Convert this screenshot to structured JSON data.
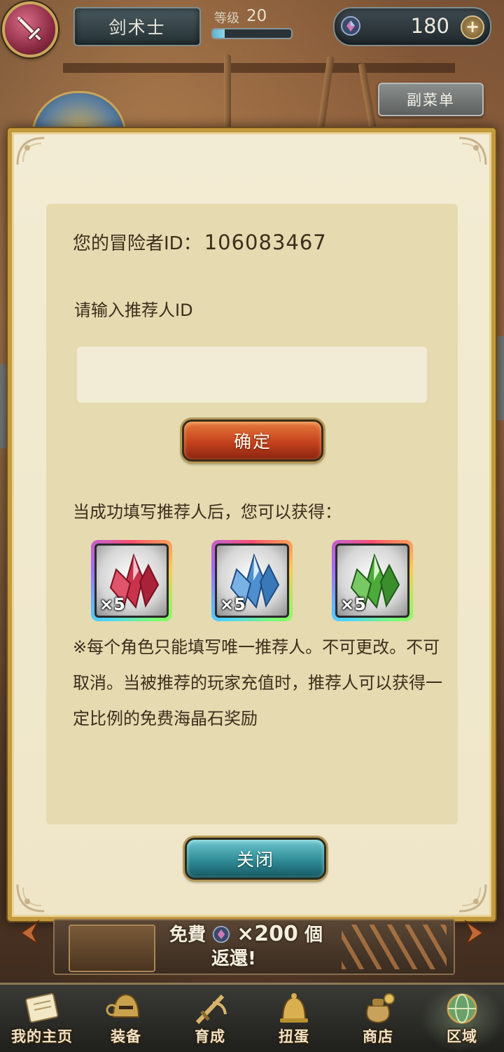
{
  "header": {
    "character_name": "剑术士",
    "level_label": "等级",
    "level_value": "20",
    "level_progress_fraction": 0.15,
    "gem_count": "180",
    "submenu_label": "副菜单"
  },
  "dialog": {
    "adventurer_id_label": "您的冒险者ID：",
    "adventurer_id": "106083467",
    "referrer_prompt": "请输入推荐人ID",
    "referrer_input_value": "",
    "confirm_label": "确定",
    "reward_intro": "当成功填写推荐人后，您可以获得：",
    "rewards": [
      {
        "name": "red-crystal-icon",
        "color": "#c8324a",
        "quantity": "×5"
      },
      {
        "name": "blue-crystal-icon",
        "color": "#4f8fd0",
        "quantity": "×5"
      },
      {
        "name": "green-crystal-icon",
        "color": "#4caa3a",
        "quantity": "×5"
      }
    ],
    "notice": "※每个角色只能填写唯一推荐人。不可更改。不可取消。当被推荐的玩家充值时，推荐人可以获得一定比例的免费海晶石奖励",
    "close_label": "关闭"
  },
  "banner": {
    "free_label": "免費",
    "amount": "×200",
    "unit": "個",
    "line2": "返還!"
  },
  "bottom_nav": {
    "items": [
      {
        "label": "我的主页",
        "icon": "scroll-icon"
      },
      {
        "label": "装备",
        "icon": "helmet-icon"
      },
      {
        "label": "育成",
        "icon": "sword-icon"
      },
      {
        "label": "扭蛋",
        "icon": "gacha-bell-icon"
      },
      {
        "label": "商店",
        "icon": "coin-bag-icon"
      },
      {
        "label": "区域",
        "icon": "globe-icon"
      }
    ]
  },
  "colors": {
    "modal_border": "#c59a3c",
    "confirm_button": "#c5421d",
    "close_button": "#2f8b97",
    "text": "#3d2e1c"
  }
}
